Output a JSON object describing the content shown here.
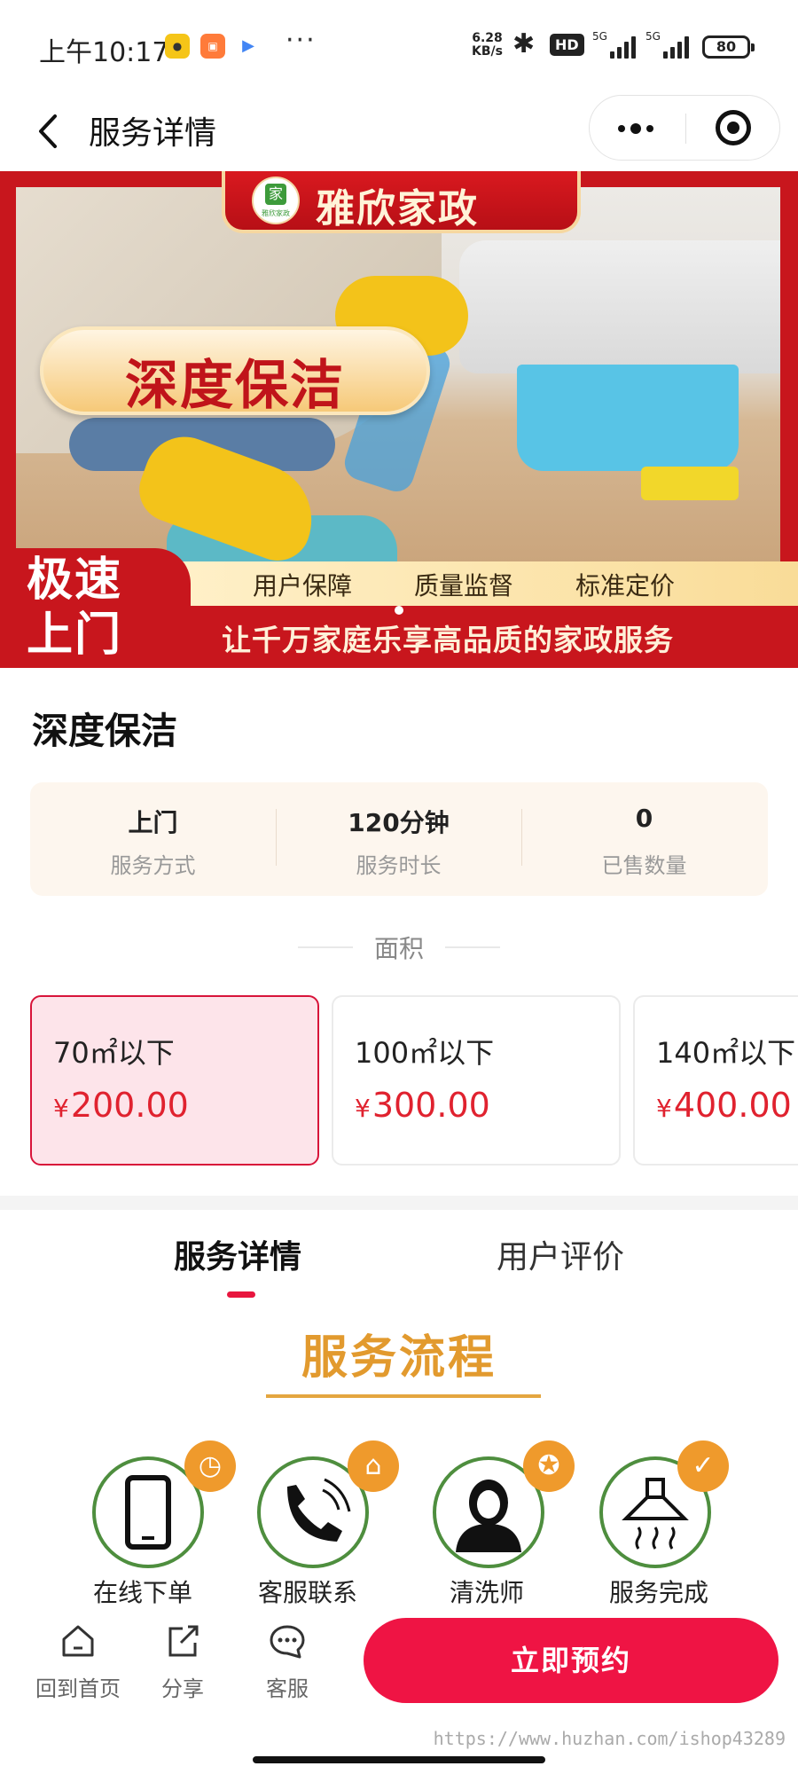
{
  "status_bar": {
    "time": "上午10:17",
    "network_speed": "6.28",
    "network_speed_unit": "KB/s",
    "hd_label": "HD",
    "signal_1": "5G",
    "signal_2": "5G",
    "battery": "80"
  },
  "nav": {
    "title": "服务详情"
  },
  "banner": {
    "brand_name": "雅欣家政",
    "brand_logo_text": "雅欣家政",
    "headline": "深度保洁",
    "fast_line1": "极速",
    "fast_line2": "上门",
    "promises": [
      "用户保障",
      "质量监督",
      "标准定价"
    ],
    "slogan": "让千万家庭乐享高品质的家政服务"
  },
  "product": {
    "title": "深度保洁",
    "info": [
      {
        "value": "上门",
        "label": "服务方式"
      },
      {
        "value": "120分钟",
        "label": "服务时长"
      },
      {
        "value": "0",
        "label": "已售数量"
      }
    ]
  },
  "area": {
    "heading": "面积",
    "currency": "¥",
    "options": [
      {
        "size": "70㎡以下",
        "price": "200.00",
        "selected": true
      },
      {
        "size": "100㎡以下",
        "price": "300.00",
        "selected": false
      },
      {
        "size": "140㎡以下",
        "price": "400.00",
        "selected": false
      }
    ]
  },
  "tabs": [
    {
      "label": "服务详情",
      "active": true
    },
    {
      "label": "用户评价",
      "active": false
    }
  ],
  "process": {
    "title": "服务流程",
    "steps": [
      {
        "label": "在线下单",
        "icon": "phone-icon",
        "badge_icon": "clock-icon"
      },
      {
        "label": "客服联系",
        "icon": "telephone-icon",
        "badge_icon": "home-icon"
      },
      {
        "label": "清洗师",
        "icon": "worker-icon",
        "badge_icon": "medal-icon"
      },
      {
        "label": "服务完成",
        "icon": "range-hood-icon",
        "badge_icon": "check-icon"
      }
    ]
  },
  "bottom_bar": {
    "home": "回到首页",
    "share": "分享",
    "service": "客服",
    "book": "立即预约"
  },
  "watermark": "https://www.huzhan.com/ishop43289",
  "colors": {
    "accent_red": "#ef1444",
    "price_red": "#e0222f",
    "banner_red": "#c8161d",
    "process_orange": "#e29a2e",
    "step_green": "#4e8e3e"
  }
}
